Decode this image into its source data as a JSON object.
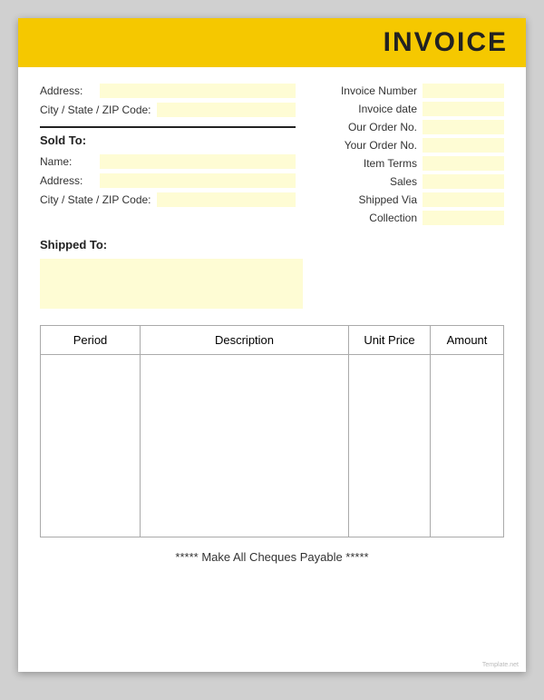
{
  "header": {
    "title": "INVOICE",
    "bg_color": "#f5c800"
  },
  "left_section": {
    "address_label": "Address:",
    "city_label": "City / State / ZIP Code:",
    "sold_to_label": "Sold To:",
    "name_label": "Name:",
    "address2_label": "Address:",
    "city2_label": "City / State / ZIP Code:"
  },
  "right_section": {
    "fields": [
      {
        "label": "Invoice Number",
        "key": "invoice_number"
      },
      {
        "label": "Invoice date",
        "key": "invoice_date"
      },
      {
        "label": "Our Order No.",
        "key": "our_order_no"
      },
      {
        "label": "Your Order No.",
        "key": "your_order_no"
      },
      {
        "label": "Item Terms",
        "key": "item_terms"
      },
      {
        "label": "Sales",
        "key": "sales"
      },
      {
        "label": "Shipped Via",
        "key": "shipped_via"
      },
      {
        "label": "Collection",
        "key": "collection"
      }
    ]
  },
  "shipped_to": {
    "label": "Shipped To:"
  },
  "table": {
    "columns": [
      "Period",
      "Description",
      "Unit Price",
      "Amount"
    ]
  },
  "footer": {
    "text": "***** Make All Cheques Payable *****"
  },
  "watermark": "Template.net"
}
